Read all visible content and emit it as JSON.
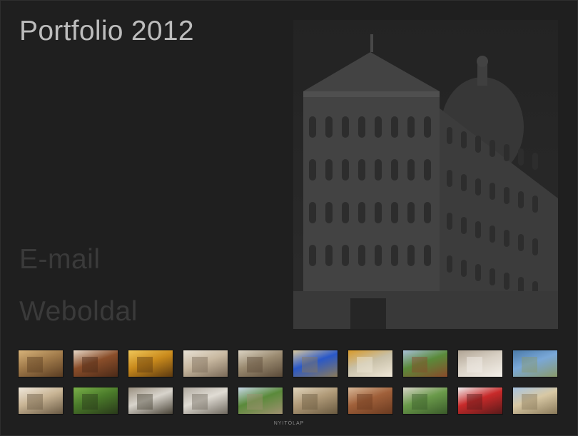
{
  "page": {
    "title": "Portfolio 2012"
  },
  "links": {
    "email": "E-mail",
    "website": "Weboldal"
  },
  "footer": {
    "home": "NYITÓLAP"
  },
  "colors": {
    "background": "#1f1f1f",
    "title": "#bdbdbd",
    "muted_link": "#3a3a3a"
  },
  "hero": {
    "subject": "cathedral-facade-photo"
  },
  "thumbnails": [
    [
      {
        "name": "arcade-corridor-thumb",
        "palette": [
          "#a07a4a",
          "#d7b37a",
          "#5a3d22"
        ]
      },
      {
        "name": "vaulted-arch-thumb",
        "palette": [
          "#8a4e2a",
          "#e8d8c8",
          "#4b2a18"
        ]
      },
      {
        "name": "golden-cloister-thumb",
        "palette": [
          "#c98a1c",
          "#f0c75a",
          "#5d3a10"
        ]
      },
      {
        "name": "old-buildings-thumb",
        "palette": [
          "#c8b8a0",
          "#e8e2d6",
          "#7a6a58"
        ]
      },
      {
        "name": "townhouse-row-thumb",
        "palette": [
          "#9a8a70",
          "#dcd4c4",
          "#5a4a38"
        ]
      },
      {
        "name": "blue-sky-tower-thumb",
        "palette": [
          "#2a58c8",
          "#d8c8a0",
          "#8a7a5a"
        ]
      },
      {
        "name": "golden-sculpture-thumb",
        "palette": [
          "#c8c0a8",
          "#d89a2a",
          "#f0e8d8"
        ]
      },
      {
        "name": "green-hillside-thumb",
        "palette": [
          "#5a8a3a",
          "#a8c0d8",
          "#8a4a2a"
        ]
      },
      {
        "name": "stone-courtyard-thumb",
        "palette": [
          "#d8d0c4",
          "#b0a494",
          "#f4f0ea"
        ]
      },
      {
        "name": "coastal-cliff-thumb",
        "palette": [
          "#7aa8d8",
          "#4a7aa8",
          "#8a9a6a"
        ]
      }
    ],
    [
      {
        "name": "clock-tower-thumb",
        "palette": [
          "#c8b494",
          "#f0e8dc",
          "#6a5a44"
        ]
      },
      {
        "name": "iron-gate-thumb",
        "palette": [
          "#4a7a2a",
          "#7ab04a",
          "#2a3a1a"
        ]
      },
      {
        "name": "urn-statue-thumb",
        "palette": [
          "#d8d4cc",
          "#9a9080",
          "#4a4438"
        ]
      },
      {
        "name": "church-front-thumb",
        "palette": [
          "#e0dcd4",
          "#b0aaa0",
          "#706a60"
        ]
      },
      {
        "name": "cypress-road-thumb",
        "palette": [
          "#5a8a3a",
          "#c8d8e8",
          "#a09070"
        ]
      },
      {
        "name": "columns-thumb",
        "palette": [
          "#b09a78",
          "#e0d4bc",
          "#6a5a40"
        ]
      },
      {
        "name": "rooftops-thumb",
        "palette": [
          "#a0603a",
          "#d8b898",
          "#6a3a20"
        ]
      },
      {
        "name": "garden-cloister-thumb",
        "palette": [
          "#6a9a4a",
          "#d8d4c8",
          "#3a5a2a"
        ]
      },
      {
        "name": "red-cable-car-thumb",
        "palette": [
          "#c82a2a",
          "#f0f0f0",
          "#5a1a1a"
        ]
      },
      {
        "name": "sandy-field-thumb",
        "palette": [
          "#d8c8a4",
          "#a8c4e0",
          "#8a7a5a"
        ]
      }
    ]
  ]
}
